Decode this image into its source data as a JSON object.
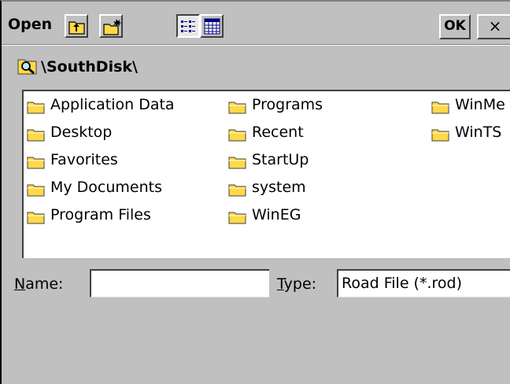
{
  "window": {
    "title": "Open",
    "ok_label": "OK",
    "close_label": "×"
  },
  "path": "\\SouthDisk\\",
  "folders": [
    [
      "Application Data",
      "Desktop",
      "Favorites",
      "My Documents",
      "Program Files"
    ],
    [
      "Programs",
      "Recent",
      "StartUp",
      "system",
      "WinEG"
    ],
    [
      "WinMe",
      "WinTS"
    ]
  ],
  "form": {
    "name_label_key": "N",
    "name_label_rest": "ame:",
    "name_value": "",
    "type_label_key": "T",
    "type_label_rest": "ype:",
    "type_value": "Road File (*.rod)"
  },
  "colors": {
    "background": "#c0c0c0",
    "folder": "#ffd94a"
  }
}
